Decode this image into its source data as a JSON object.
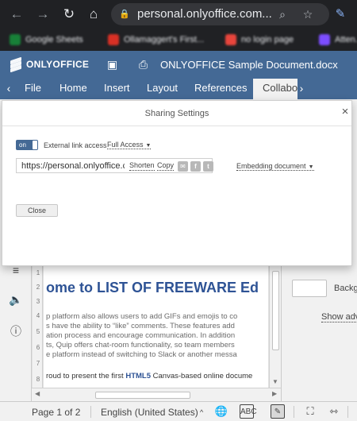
{
  "browser": {
    "url": "personal.onlyoffice.com...",
    "bookmarks": [
      {
        "label": "Google Sheets",
        "color": "#188038"
      },
      {
        "label": "Ollamaggert's First...",
        "color": "#d93025"
      },
      {
        "label": "no login page",
        "color": "#e8453c"
      },
      {
        "label": "Atten...",
        "color": "#7c4dff"
      }
    ]
  },
  "app": {
    "logo_text": "ONLYOFFICE",
    "document_title": "ONLYOFFICE Sample Document.docx",
    "header_color": "#446995",
    "tabs": [
      {
        "label": "File"
      },
      {
        "label": "Home"
      },
      {
        "label": "Insert"
      },
      {
        "label": "Layout"
      },
      {
        "label": "References"
      },
      {
        "label": "Collabo"
      }
    ]
  },
  "dialog": {
    "title": "Sharing Settings",
    "toggle_label": "on",
    "external_link_label": "External link access",
    "access_value": "Full Access",
    "link_url": "https://personal.onlyoffice.com",
    "shorten_label": "Shorten",
    "copy_label": "Copy",
    "share_icons": [
      "mail-icon",
      "facebook-icon",
      "twitter-icon"
    ],
    "embedding_label": "Embedding document",
    "close_label": "Close"
  },
  "document": {
    "heading": "ome to LIST OF FREEWARE Ed",
    "lines": [
      "p platform also allows users to add GIFs and emojis to co",
      "s have  the ability to “like” comments. These features add",
      "ation process and encourage communication. In addition",
      "ts, Quip offers chat-room functionality, so team members",
      "e platform instead of switching to Slack or another messa"
    ],
    "last_line_prefix": "roud to present the first ",
    "last_line_accent": "HTML5",
    "last_line_suffix": " Canvas-based online docume",
    "ruler_numbers": [
      "1",
      "2",
      "3",
      "4",
      "5",
      "6",
      "7",
      "8"
    ]
  },
  "right_panel": {
    "background_label": "Backg",
    "advanced_label": "Show adv"
  },
  "status": {
    "page_info": "Page 1 of 2",
    "language": "English (United States)"
  }
}
